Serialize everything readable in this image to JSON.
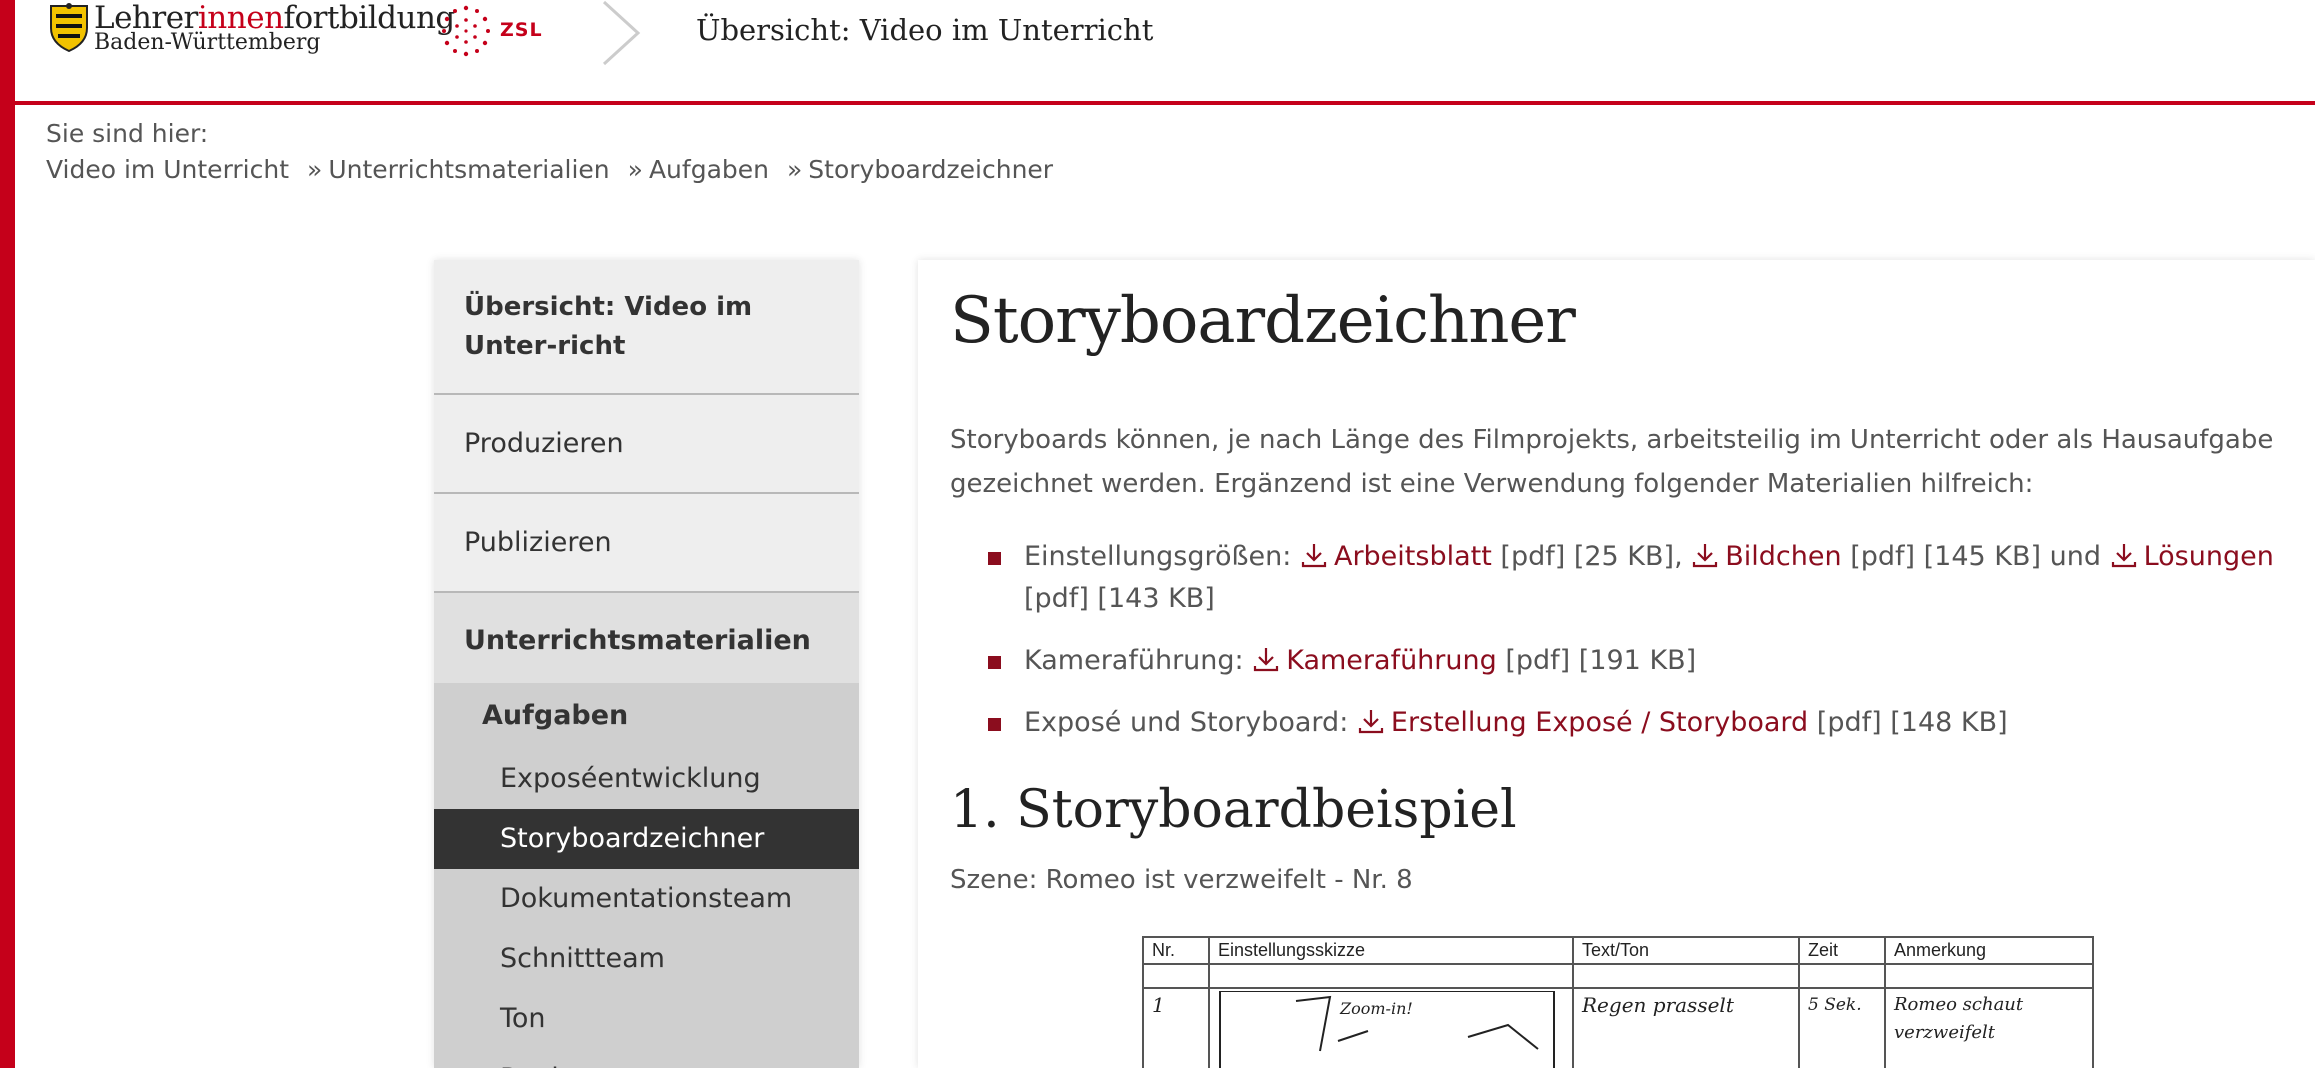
{
  "header": {
    "logo_line1_a": "Lehrer",
    "logo_line1_b": "innen",
    "logo_line1_c": "fortbildung",
    "logo_line2": "Baden-Württemberg",
    "zsl": "ZSL",
    "title": "Übersicht: Video im Unterricht"
  },
  "breadcrumb": {
    "label": "Sie sind hier:",
    "items": [
      "Video im Unterricht",
      "Unterrichtsmaterialien",
      "Aufgaben",
      "Storyboardzeichner"
    ],
    "separator": "»"
  },
  "sidebar": {
    "title": "Übersicht: Video im Unter-richt",
    "items": [
      "Produzieren",
      "Publizieren",
      "Unterrichtsmaterialien"
    ],
    "sub": "Aufgaben",
    "subitems": [
      "Exposéentwicklung",
      "Storyboardzeichner",
      "Dokumentationsteam",
      "Schnittteam",
      "Ton",
      "Regie"
    ]
  },
  "content": {
    "title": "Storyboardzeichner",
    "intro": "Storyboards können, je nach Länge des Filmprojekts, arbeitsteilig im Unterricht oder als Hausaufgabe gezeichnet werden. Ergänzend ist eine Verwendung folgender Materialien hilfreich:",
    "list": [
      {
        "label": "Einstellungsgrößen:",
        "links": [
          {
            "text": "Arbeitsblatt",
            "meta": "[pdf] [25 KB],"
          },
          {
            "text": "Bildchen",
            "meta": "[pdf] [145 KB] und"
          },
          {
            "text": "Lösungen",
            "meta": "[pdf] [143 KB]"
          }
        ]
      },
      {
        "label": "Kameraführung:",
        "links": [
          {
            "text": "Kameraführung",
            "meta": "[pdf] [191 KB]"
          }
        ]
      },
      {
        "label": "Exposé und Storyboard:",
        "links": [
          {
            "text": "Erstellung Exposé / Storyboard",
            "meta": "[pdf] [148 KB]"
          }
        ]
      }
    ],
    "section_title": "1. Storyboardbeispiel",
    "scene": "Szene: Romeo ist verzweifelt - Nr. 8"
  },
  "storyboard": {
    "headers": [
      "Nr.",
      "Einstellungsskizze",
      "Text/Ton",
      "Zeit",
      "Anmerkung"
    ],
    "row_nr": "1",
    "sketch_note": "Zoom-in!",
    "text_ton": "Regen prasselt",
    "zeit": "5 Sek.",
    "anmerkung": "Romeo schaut verzweifelt"
  },
  "colors": {
    "brand_red": "#c5001a",
    "link_red": "#8b0d1e",
    "active_nav": "#333333"
  },
  "icons": [
    "crest-icon",
    "zsl-dots-icon",
    "chevron-right-icon",
    "download-icon"
  ]
}
